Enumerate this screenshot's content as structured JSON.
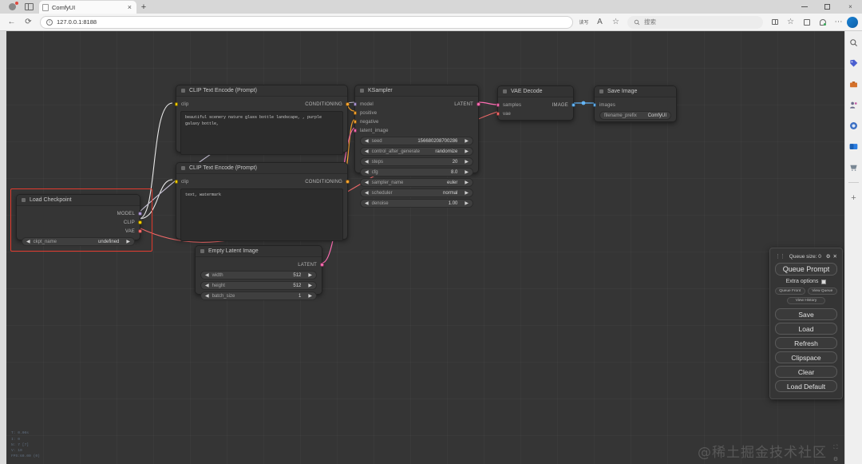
{
  "browser": {
    "tab": {
      "title": "ComfyUI",
      "close_label": "×"
    },
    "new_tab_label": "+",
    "address": "127.0.0.1:8188",
    "search_placeholder": "搜索",
    "nav": {
      "back": "←",
      "reload": "⟳",
      "info": "i"
    },
    "toolbar_icons": [
      "split-screen-icon",
      "favorites-icon",
      "collections-icon",
      "copilot-icon",
      "more-icon"
    ],
    "read_aloud_label": "读写",
    "font_label": "A",
    "star_label": "☆",
    "window": {
      "minimize": "–",
      "maximize": "□",
      "close": "×"
    },
    "sidebar_icons": [
      "search-icon",
      "discount-icon",
      "tools-icon",
      "contacts-icon",
      "camera-icon",
      "outlook-icon",
      "shopping-icon",
      "add-icon"
    ]
  },
  "nodes": {
    "clip_positive": {
      "title": "CLIP Text Encode (Prompt)",
      "input": "clip",
      "output": "CONDITIONING",
      "text": "beautiful scenery nature glass bottle landscape, , purple galaxy bottle,"
    },
    "clip_negative": {
      "title": "CLIP Text Encode (Prompt)",
      "input": "clip",
      "output": "CONDITIONING",
      "text": "text, watermark"
    },
    "ksampler": {
      "title": "KSampler",
      "inputs": [
        "model",
        "positive",
        "negative",
        "latent_image"
      ],
      "output": "LATENT",
      "widgets": [
        {
          "name": "seed",
          "value": "156680208700286"
        },
        {
          "name": "control_after_generate",
          "value": "randomize"
        },
        {
          "name": "steps",
          "value": "20"
        },
        {
          "name": "cfg",
          "value": "8.0"
        },
        {
          "name": "sampler_name",
          "value": "euler"
        },
        {
          "name": "scheduler",
          "value": "normal"
        },
        {
          "name": "denoise",
          "value": "1.00"
        }
      ]
    },
    "vae_decode": {
      "title": "VAE Decode",
      "inputs": [
        "samples",
        "vae"
      ],
      "output": "IMAGE"
    },
    "save_image": {
      "title": "Save Image",
      "input": "images",
      "widget": {
        "name": "filename_prefix",
        "value": "ComfyUI"
      }
    },
    "load_checkpoint": {
      "title": "Load Checkpoint",
      "outputs": [
        "MODEL",
        "CLIP",
        "VAE"
      ],
      "widget": {
        "name": "ckpt_name",
        "value": "undefined"
      },
      "selected": true
    },
    "empty_latent": {
      "title": "Empty Latent Image",
      "output": "LATENT",
      "widgets": [
        {
          "name": "width",
          "value": "512"
        },
        {
          "name": "height",
          "value": "512"
        },
        {
          "name": "batch_size",
          "value": "1"
        }
      ]
    }
  },
  "menu": {
    "queue_size_label": "Queue size: 0",
    "settings_icon": "⚙",
    "close_icon": "✕",
    "queue_prompt": "Queue Prompt",
    "extra_options": "Extra options",
    "queue_front": "Queue Front",
    "view_queue": "View Queue",
    "view_history": "View History",
    "save": "Save",
    "load": "Load",
    "refresh": "Refresh",
    "clipspace": "Clipspace",
    "clear": "Clear",
    "load_default": "Load Default"
  },
  "canvas": {
    "debug": "T: 0.00s\nI: 0\nN: 7 [7]\nV: 10\nFPS:60.00 (0)",
    "watermark": "@稀土掘金技术社区"
  },
  "colors": {
    "accent_selection": "#e23b2e",
    "conditioning": "#ffa931",
    "latent": "#ff6eb4",
    "model": "#b39ddb",
    "clip": "#ffd500",
    "vae": "#ff6e6e",
    "image": "#64b5f6",
    "node_bg": "#353535",
    "canvas_bg": "#353535"
  }
}
